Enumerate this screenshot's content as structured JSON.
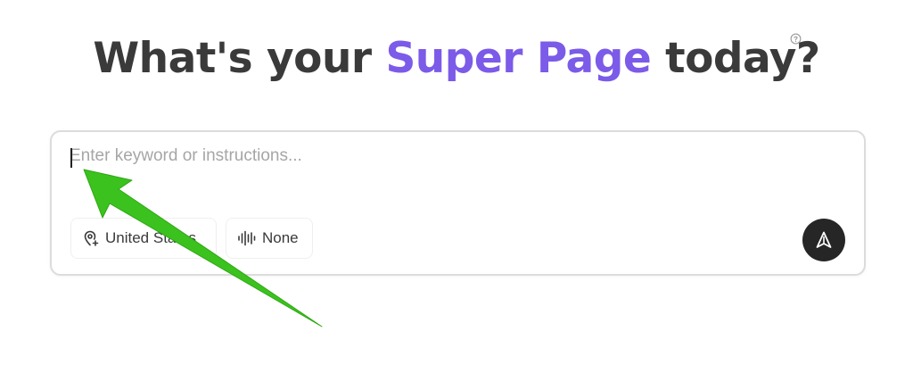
{
  "header": {
    "title_prefix": "What's your ",
    "title_highlight": "Super Page",
    "title_suffix": " today?",
    "accent_color": "#7b5be8",
    "help_icon": "question-circle-icon"
  },
  "composer": {
    "placeholder": "Enter keyword or instructions...",
    "value": "",
    "location_chip": {
      "label": "United States",
      "icon": "map-pin-plus-icon"
    },
    "voice_chip": {
      "label": "None",
      "icon": "waveform-icon"
    },
    "send_icon": "send-arrow-icon"
  },
  "annotation": {
    "type": "arrow",
    "color": "#3cc21e"
  }
}
